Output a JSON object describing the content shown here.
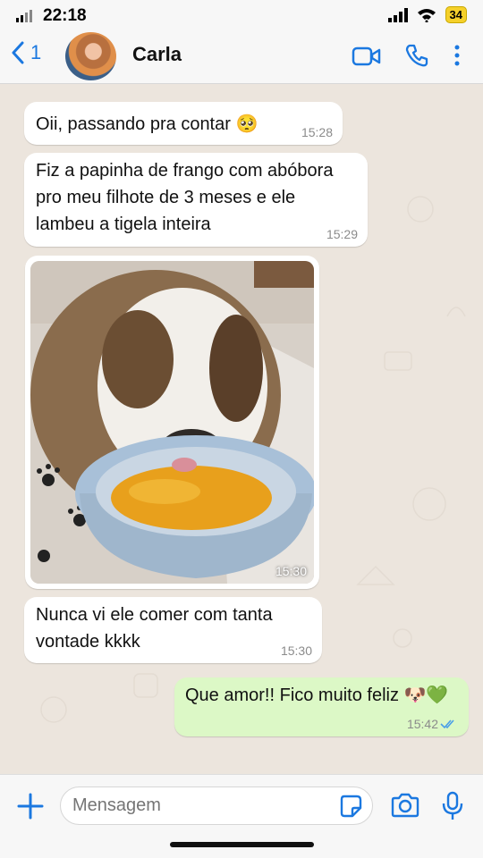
{
  "status_bar": {
    "time": "22:18",
    "battery": "34"
  },
  "header": {
    "back_count": "1",
    "contact_name": "Carla"
  },
  "messages": [
    {
      "text": "Oii, passando pra contar 🥺",
      "time": "15:28"
    },
    {
      "text": "Fiz a papinha de frango com abóbora pro meu filhote de 3 meses e ele lambeu a tigela inteira",
      "time": "15:29"
    },
    {
      "text": "",
      "time": "15:30"
    },
    {
      "text": "Nunca vi ele comer com tanta vontade kkkk",
      "time": "15:30"
    },
    {
      "text": "Que amor!! Fico muito feliz 🐶💚",
      "time": "15:42"
    }
  ],
  "composer": {
    "placeholder": "Mensagem"
  },
  "colors": {
    "accent": "#1b78e0",
    "outgoing_bubble": "#dcf8c6",
    "incoming_bubble": "#ffffff",
    "chat_bg": "#ece5dd"
  }
}
